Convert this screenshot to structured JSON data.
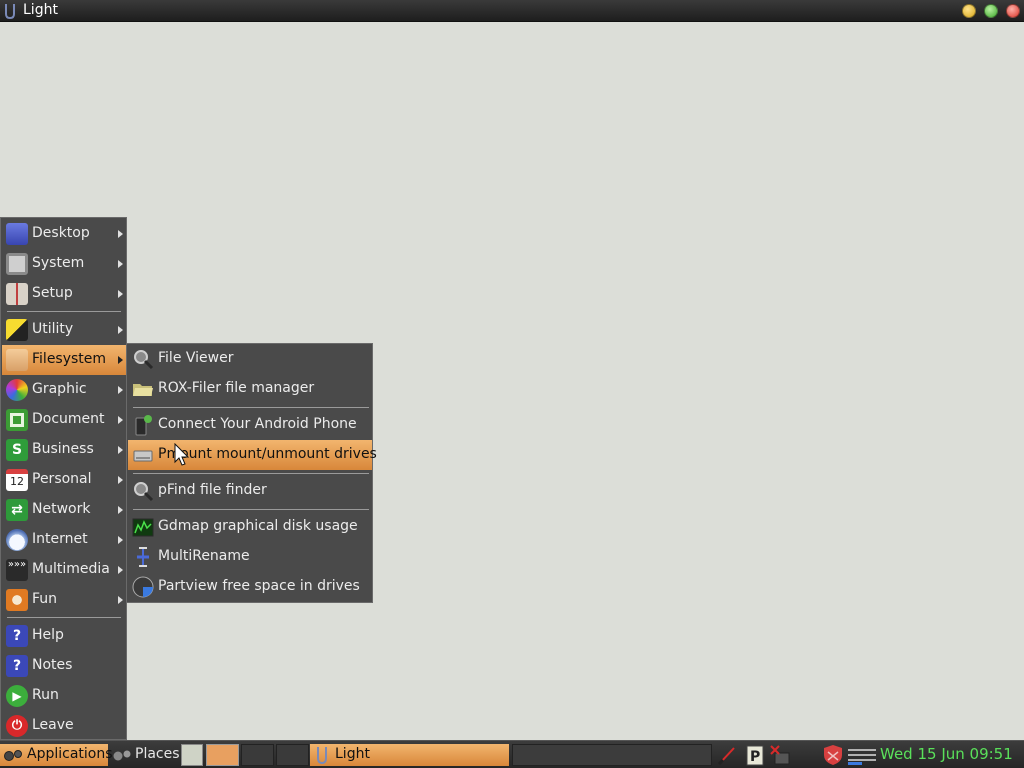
{
  "window": {
    "title": "Light"
  },
  "menu": {
    "items": [
      {
        "label": "Desktop",
        "icon": "desktop-icon",
        "color": "#4a5bd0"
      },
      {
        "label": "System",
        "icon": "monitor-icon",
        "color": "#b8b8b8"
      },
      {
        "label": "Setup",
        "icon": "setup-icon",
        "color": "#c9c0b6"
      },
      {
        "label": "Utility",
        "icon": "utility-icon",
        "color": "#f2d21e"
      },
      {
        "label": "Filesystem",
        "icon": "folder-icon",
        "color": "#e9b97e"
      },
      {
        "label": "Graphic",
        "icon": "graphic-icon",
        "color": "#e24a8a"
      },
      {
        "label": "Document",
        "icon": "document-icon",
        "color": "#3c9b35"
      },
      {
        "label": "Business",
        "icon": "business-icon",
        "color": "#2f9c3a"
      },
      {
        "label": "Personal",
        "icon": "calendar-icon",
        "color": "#ffffff",
        "badge": "12"
      },
      {
        "label": "Network",
        "icon": "network-icon",
        "color": "#2e9a3a"
      },
      {
        "label": "Internet",
        "icon": "cloud-icon",
        "color": "#d8e4f4"
      },
      {
        "label": "Multimedia",
        "icon": "multimedia-icon",
        "color": "#2a2a2a"
      },
      {
        "label": "Fun",
        "icon": "puzzle-icon",
        "color": "#e07a22"
      },
      {
        "label": "Help",
        "icon": "help-icon",
        "color": "#3b48b8"
      },
      {
        "label": "Notes",
        "icon": "notes-icon",
        "color": "#3b48b8"
      },
      {
        "label": "Run",
        "icon": "run-icon",
        "color": "#3cae3c"
      },
      {
        "label": "Leave",
        "icon": "power-icon",
        "color": "#d8282a"
      }
    ],
    "active": "Filesystem"
  },
  "submenu": {
    "items": [
      {
        "label": "File Viewer",
        "icon": "magnifier-icon"
      },
      {
        "label": "ROX-Filer file manager",
        "icon": "folder-open-icon"
      },
      {
        "label": "Connect Your Android Phone",
        "icon": "android-phone-icon"
      },
      {
        "label": "Pmount mount/unmount drives",
        "icon": "drive-icon"
      },
      {
        "label": "pFind file finder",
        "icon": "magnifier-icon"
      },
      {
        "label": "Gdmap graphical disk usage",
        "icon": "disk-map-icon"
      },
      {
        "label": "MultiRename",
        "icon": "rename-icon"
      },
      {
        "label": "Partview free space in drives",
        "icon": "pie-icon"
      }
    ],
    "active": "Pmount mount/unmount drives"
  },
  "taskbar": {
    "applications_label": "Applications",
    "places_label": "Places",
    "task_label": "Light",
    "clock": "Wed 15 Jun 09:51"
  },
  "colors": {
    "accent": "#e8a060",
    "menu_bg": "#4a4a4a",
    "desktop_bg": "#dcded8",
    "clock": "#5ae05a"
  }
}
